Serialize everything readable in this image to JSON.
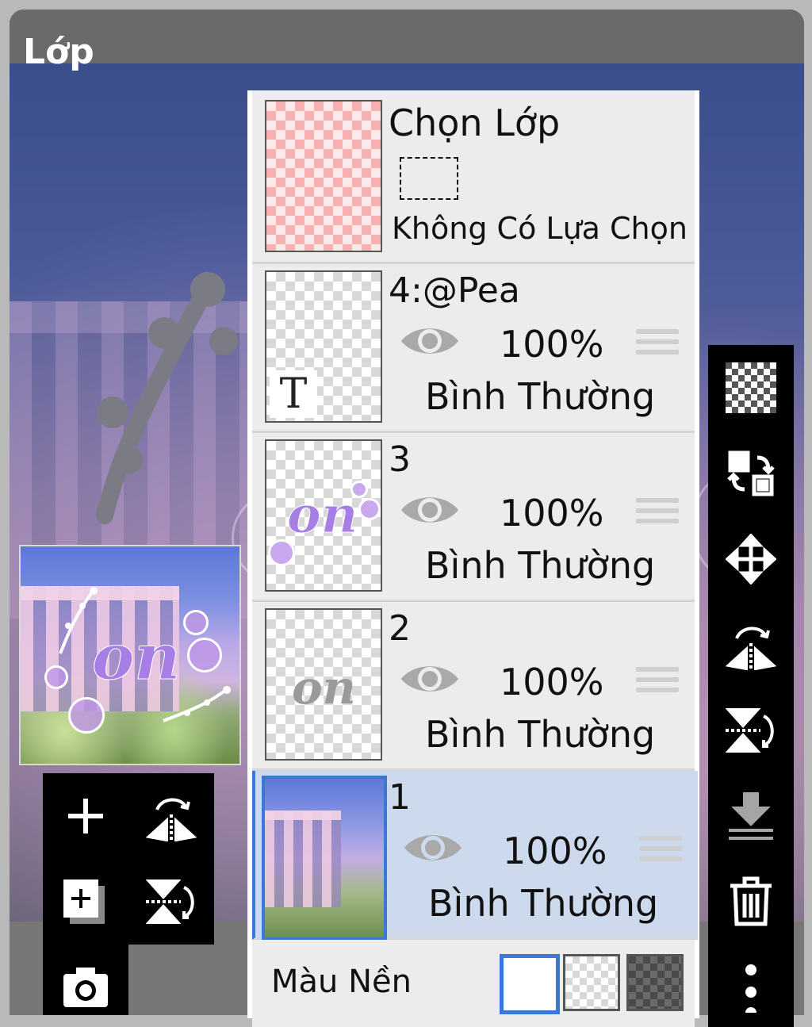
{
  "header": {
    "title": "Lớp"
  },
  "selection_row": {
    "title": "Chọn Lớp",
    "status": "Không Có Lựa Chọn"
  },
  "layers": [
    {
      "name": "4:@Pea",
      "opacity": "100%",
      "blend": "Bình Thường",
      "thumb_text": "T",
      "selected": false
    },
    {
      "name": "3",
      "opacity": "100%",
      "blend": "Bình Thường",
      "thumb_text": "on",
      "selected": false
    },
    {
      "name": "2",
      "opacity": "100%",
      "blend": "Bình Thường",
      "thumb_text": "on",
      "selected": false
    },
    {
      "name": "1",
      "opacity": "100%",
      "blend": "Bình Thường",
      "selected": true
    }
  ],
  "background": {
    "label": "Màu Nền",
    "options": [
      "white",
      "transparent",
      "dark-checker"
    ],
    "selected": "white"
  },
  "preview": {
    "text": "on"
  },
  "colors": {
    "accent": "#3a78d8",
    "selected_row": "#cdd9ec",
    "row": "#ececec",
    "toolbar": "#000000"
  },
  "right_toolbar_icons": [
    "transparency-checker-icon",
    "swap-layer-icon",
    "move-icon",
    "flip-horizontal-icon",
    "flip-vertical-icon",
    "merge-down-icon",
    "trash-icon",
    "more-icon"
  ],
  "left_toolbar_icons": [
    "add-layer-icon",
    "flip-horizontal-icon",
    "add-layer-copy-icon",
    "flip-vertical-icon",
    "camera-icon"
  ]
}
